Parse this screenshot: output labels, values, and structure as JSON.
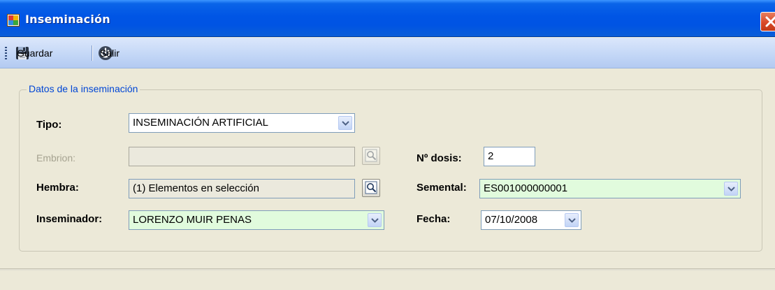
{
  "window": {
    "title": "Inseminación",
    "icon": "app-form-icon"
  },
  "toolbar": {
    "guardar_label": "Guardar",
    "salir_label": "Salir",
    "guardar_icon": "save-disk-icon",
    "salir_icon": "power-icon"
  },
  "group": {
    "legend": "Datos de la inseminación"
  },
  "form": {
    "tipo": {
      "label": "Tipo:",
      "value": "INSEMINACIÓN ARTIFICIAL"
    },
    "embrion": {
      "label": "Embrion:",
      "value": ""
    },
    "dosis": {
      "label": "Nº dosis:",
      "value": "2"
    },
    "hembra": {
      "label": "Hembra:",
      "value": "(1) Elementos en selección"
    },
    "semental": {
      "label": "Semental:",
      "value": "ES001000000001"
    },
    "inseminador": {
      "label": "Inseminador:",
      "value": "LORENZO MUIR PENAS"
    },
    "fecha": {
      "label": "Fecha:",
      "value": "07/10/2008"
    }
  },
  "colors": {
    "titlebar": "#0054e3",
    "toolbar": "#c2d6f6",
    "window_bg": "#ece9d8",
    "legend_text": "#0046d5",
    "required_field_bg": "#e1fbdd",
    "close_button": "#d9492a"
  }
}
